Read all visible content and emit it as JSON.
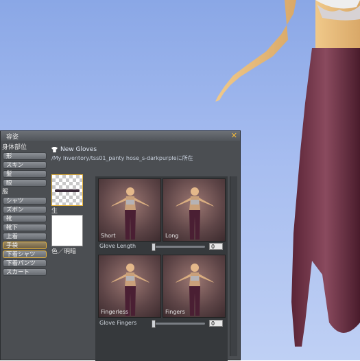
{
  "window": {
    "title": "容姿",
    "close_icon": "close-icon"
  },
  "body_parts": {
    "section_label": "身体部位",
    "items": [
      {
        "label": "形",
        "state": "normal"
      },
      {
        "label": "スキン",
        "state": "normal"
      },
      {
        "label": "髪",
        "state": "normal"
      },
      {
        "label": "眼",
        "state": "normal"
      }
    ]
  },
  "clothes": {
    "section_label": "服",
    "items": [
      {
        "label": "シャツ",
        "state": "normal"
      },
      {
        "label": "ズボン",
        "state": "normal"
      },
      {
        "label": "靴",
        "state": "normal"
      },
      {
        "label": "靴下",
        "state": "normal"
      },
      {
        "label": "上着",
        "state": "normal"
      },
      {
        "label": "手袋",
        "state": "selected"
      },
      {
        "label": "下着シャツ",
        "state": "hilite"
      },
      {
        "label": "下着パンツ",
        "state": "normal"
      },
      {
        "label": "スカート",
        "state": "normal"
      }
    ]
  },
  "item": {
    "name": "New Gloves",
    "path": "/My Inventory/tss01_panty hose_s-darkpurpleに所在"
  },
  "texture": {
    "label": "生地"
  },
  "color": {
    "label": "色／明暗",
    "value": "#ffffff"
  },
  "params": {
    "row1": [
      {
        "label": "Short"
      },
      {
        "label": "Long"
      }
    ],
    "slider1": {
      "label": "Glove Length",
      "value": "0"
    },
    "row2": [
      {
        "label": "Fingerless"
      },
      {
        "label": "Fingers"
      }
    ],
    "slider2": {
      "label": "Glove Fingers",
      "value": "0"
    }
  }
}
